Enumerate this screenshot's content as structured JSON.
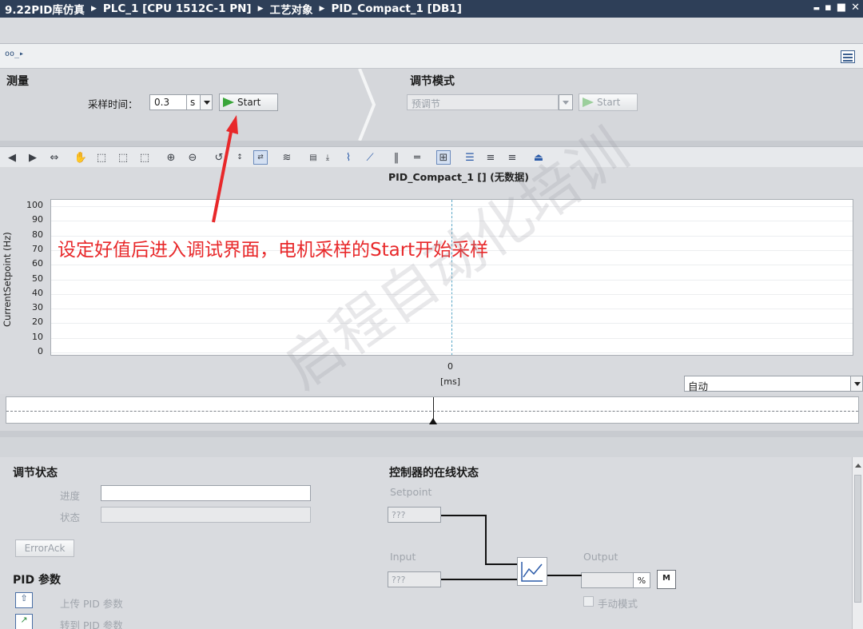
{
  "titlebar": {
    "crumbs": [
      "9.22PID库仿真",
      "PLC_1 [CPU 1512C-1 PN]",
      "工艺对象",
      "PID_Compact_1 [DB1]"
    ],
    "window_buttons": [
      "▬",
      "▪",
      "■",
      "✕"
    ]
  },
  "measure": {
    "title": "测量",
    "sample_label": "采样时间：",
    "sample_value": "0.3",
    "sample_unit": "s",
    "start_label": "Start"
  },
  "tuning": {
    "title": "调节模式",
    "mode_value": "预调节",
    "start_label": "Start"
  },
  "graph": {
    "title": "PID_Compact_1 [] (无数据)",
    "y_label": "CurrentSetpoint (Hz)",
    "y_ticks": [
      "100",
      "90",
      "80",
      "70",
      "60",
      "50",
      "40",
      "30",
      "20",
      "10",
      "0"
    ],
    "x_zero": "0",
    "x_unit": "[ms]",
    "scale_mode": "自动"
  },
  "status": {
    "title": "调节状态",
    "progress_label": "进度",
    "state_label": "状态",
    "error_ack": "ErrorAck"
  },
  "pid_params": {
    "title": "PID 参数",
    "upload_label": "上传 PID 参数",
    "goto_label": "转到 PID 参数"
  },
  "online": {
    "title": "控制器的在线状态",
    "setpoint_label": "Setpoint",
    "setpoint_value": "???",
    "input_label": "Input",
    "input_value": "???",
    "output_label": "Output",
    "output_unit": "%",
    "manual_label": "手动模式"
  },
  "annotation": "设定好值后进入调试界面，电机采样的Start开始采样",
  "watermark": "启程自动化培训",
  "colors": {
    "annotation": "#e8282a",
    "play": "#3aa53a",
    "titlebar": "#2e3f58"
  }
}
